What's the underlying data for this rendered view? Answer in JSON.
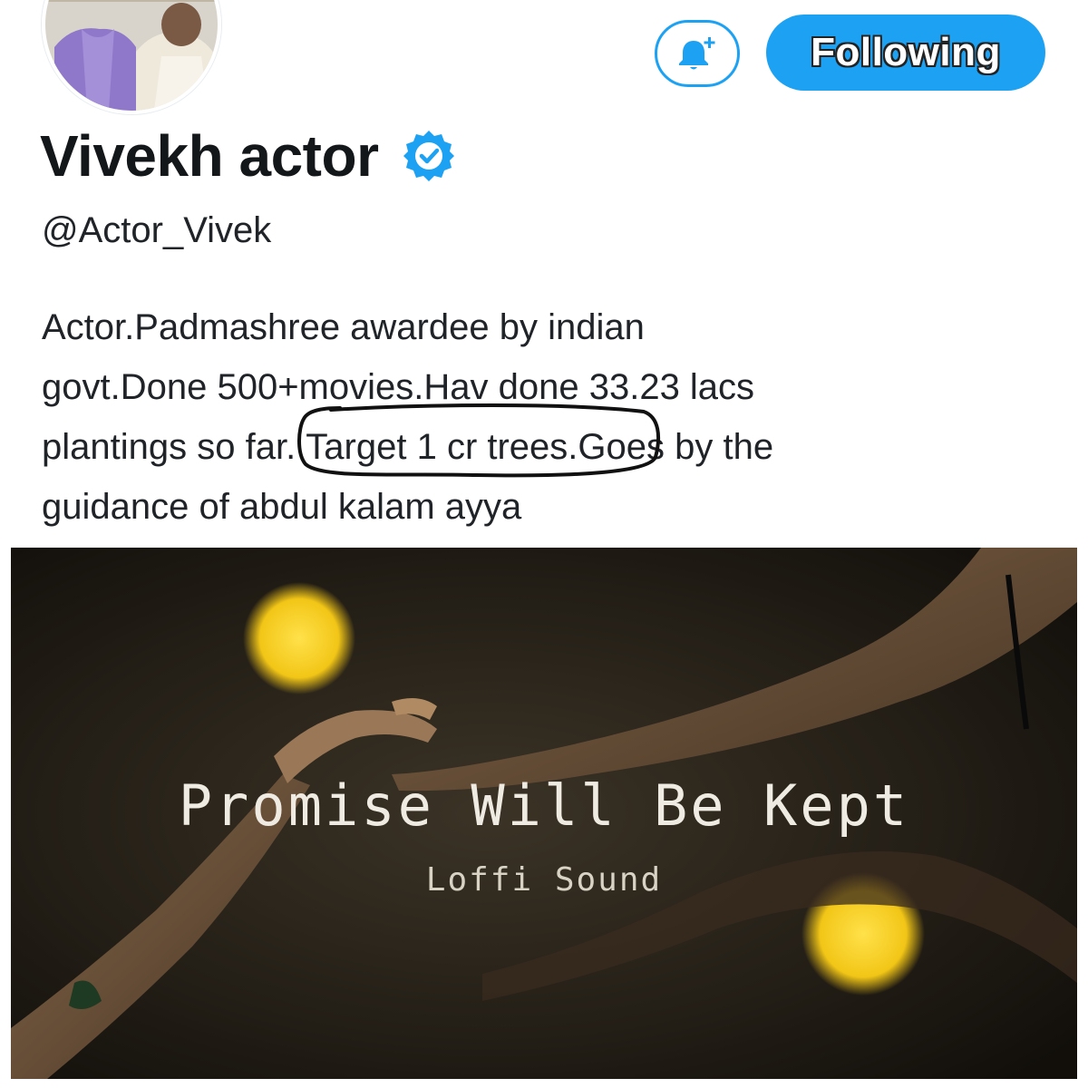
{
  "profile": {
    "display_name": "Vivekh actor",
    "handle": "@Actor_Vivek",
    "verified": true,
    "avatar_icon": "profile-photo",
    "bio_lines": [
      "Actor.Padmashree awardee by indian",
      "govt.Done 500+movies.Hav done 33.23 lacs"
    ],
    "bio_line3_before": "plantings so far. ",
    "bio_line3_circled": "Target 1 cr trees.",
    "bio_line3_after": "Goes by the",
    "bio_line4": "guidance of abdul kalam ayya"
  },
  "actions": {
    "notifications_icon": "bell-plus-icon",
    "follow_label": "Following"
  },
  "media": {
    "title": "Promise Will Be Kept",
    "subtitle": "Loffi Sound"
  },
  "colors": {
    "accent": "#1da1f2",
    "text": "#14171a",
    "annotation": "#111111",
    "bokeh": "#f2c617"
  }
}
